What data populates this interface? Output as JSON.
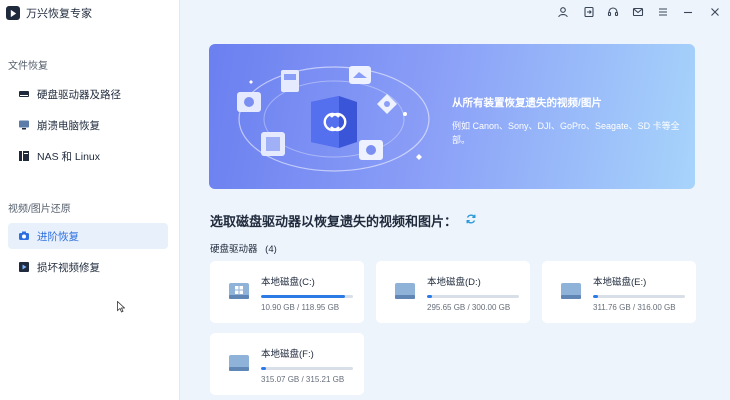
{
  "app": {
    "title": "万兴恢复专家"
  },
  "sidebar": {
    "section1": "文件恢复",
    "items1": [
      {
        "label": "硬盘驱动器及路径",
        "icon": "hard-drive-icon"
      },
      {
        "label": "崩溃电脑恢复",
        "icon": "monitor-icon"
      },
      {
        "label": "NAS 和 Linux",
        "icon": "nas-icon"
      }
    ],
    "section2": "视频/图片还原",
    "items2": [
      {
        "label": "进阶恢复",
        "icon": "camera-icon",
        "active": true
      },
      {
        "label": "损坏视频修复",
        "icon": "video-repair-icon"
      }
    ]
  },
  "topbar": {
    "icons": [
      "user-icon",
      "login-icon",
      "headset-icon",
      "mail-icon",
      "menu-icon",
      "minimize-icon",
      "close-icon"
    ]
  },
  "banner": {
    "title": "从所有装置恢复遗失的视频/图片",
    "desc": "例如 Canon、Sony、DJI、GoPro、Seagate、SD 卡等全部。"
  },
  "main": {
    "heading": "选取磁盘驱动器以恢复遗失的视频和图片：",
    "drives_label": "硬盘驱动器",
    "drives_count": "(4)"
  },
  "drives": [
    {
      "name": "本地磁盘(C:)",
      "size": "10.90 GB / 118.95 GB",
      "fill": 0.908,
      "system": true
    },
    {
      "name": "本地磁盘(D:)",
      "size": "295.65 GB / 300.00 GB",
      "fill": 0.05
    },
    {
      "name": "本地磁盘(E:)",
      "size": "311.76 GB / 316.00 GB",
      "fill": 0.05
    },
    {
      "name": "本地磁盘(F:)",
      "size": "315.07 GB / 315.21 GB",
      "fill": 0.05
    }
  ],
  "colors": {
    "accent": "#2c7be5",
    "active_bg": "#e8f0fb",
    "banner_start": "#6b7ff0",
    "banner_end": "#a7d4fb"
  }
}
